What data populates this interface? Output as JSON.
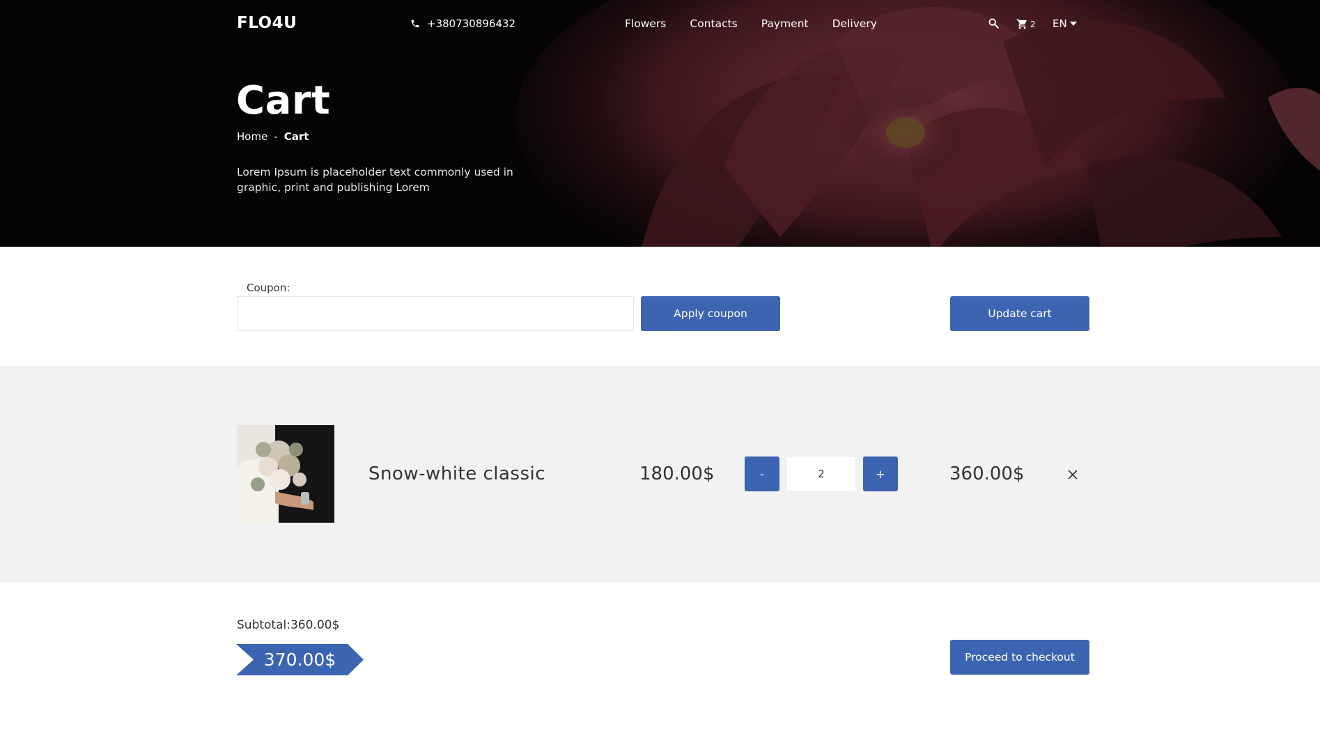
{
  "header": {
    "logo": "FLO4U",
    "phone": "+380730896432",
    "nav": [
      "Flowers",
      "Contacts",
      "Payment",
      "Delivery"
    ],
    "cart_count": "2",
    "language": "EN"
  },
  "hero": {
    "title": "Cart",
    "breadcrumb": {
      "home": "Home",
      "separator": "-",
      "current": "Cart"
    },
    "description": "Lorem Ipsum is placeholder text commonly used in graphic, print and publishing Lorem"
  },
  "coupon": {
    "label": "Coupon:",
    "value": "",
    "apply_label": "Apply coupon",
    "update_label": "Update cart"
  },
  "cart": {
    "items": [
      {
        "name": "Snow-white classic",
        "price": "180.00$",
        "quantity": "2",
        "minus_label": "-",
        "plus_label": "+",
        "total": "360.00$"
      }
    ]
  },
  "summary": {
    "subtotal_label": "Subtotal:",
    "subtotal_value": "360.00$",
    "total": "370.00$",
    "checkout_label": "Proceed to checkout"
  },
  "colors": {
    "accent": "#3d64b1",
    "hero_bg": "#050304",
    "cart_bg": "#f2f2f2"
  }
}
